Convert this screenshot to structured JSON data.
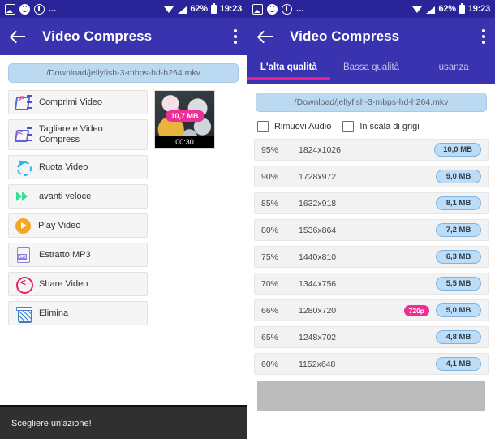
{
  "status_bar": {
    "icons": [
      "photo-icon",
      "smiley-icon",
      "info-icon",
      "more-dots-icon"
    ],
    "dots": "...",
    "battery_percent": "62%",
    "time": "19:23",
    "right_icons": [
      "wifi-icon",
      "signal-icon",
      "battery-icon"
    ]
  },
  "app_bar": {
    "title": "Video Compress",
    "back_icon": "back-arrow-icon",
    "overflow_icon": "overflow-menu-icon"
  },
  "left_screen": {
    "file_path": "/Download/jellyfish-3-mbps-hd-h264.mkv",
    "actions": [
      {
        "label": "Comprimi Video",
        "icon": "compress-video-icon"
      },
      {
        "label": "Tagliare e Video Compress",
        "icon": "cut-video-icon"
      },
      {
        "label": "Ruota Video",
        "icon": "rotate-video-icon"
      },
      {
        "label": "avanti veloce",
        "icon": "fast-forward-icon"
      },
      {
        "label": "Play Video",
        "icon": "play-video-icon"
      },
      {
        "label": "Estratto MP3",
        "icon": "mp3-file-icon"
      },
      {
        "label": "Share Video",
        "icon": "share-icon"
      },
      {
        "label": "Elimina",
        "icon": "trash-icon"
      }
    ],
    "thumbnail": {
      "size_badge": "10,7 MB",
      "duration": "00:30"
    },
    "toast": "Scegliere un'azione!"
  },
  "right_screen": {
    "tabs": [
      {
        "label": "L'alta qualità",
        "active": true
      },
      {
        "label": "Bassa qualità",
        "active": false
      },
      {
        "label": "usanza",
        "active": false
      }
    ],
    "file_path": "/Download/jellyfish-3-mbps-hd-h264.mkv",
    "options": [
      {
        "label": "Rimuovi Audio",
        "checked": false
      },
      {
        "label": "In scala di grigi",
        "checked": false
      }
    ],
    "qualities": [
      {
        "percent": "95%",
        "resolution": "1824x1026",
        "tag": "",
        "size": "10,0 MB"
      },
      {
        "percent": "90%",
        "resolution": "1728x972",
        "tag": "",
        "size": "9,0 MB"
      },
      {
        "percent": "85%",
        "resolution": "1632x918",
        "tag": "",
        "size": "8,1 MB"
      },
      {
        "percent": "80%",
        "resolution": "1536x864",
        "tag": "",
        "size": "7,2 MB"
      },
      {
        "percent": "75%",
        "resolution": "1440x810",
        "tag": "",
        "size": "6,3 MB"
      },
      {
        "percent": "70%",
        "resolution": "1344x756",
        "tag": "",
        "size": "5,5 MB"
      },
      {
        "percent": "66%",
        "resolution": "1280x720",
        "tag": "720p",
        "size": "5,0 MB"
      },
      {
        "percent": "65%",
        "resolution": "1248x702",
        "tag": "",
        "size": "4,8 MB"
      },
      {
        "percent": "60%",
        "resolution": "1152x648",
        "tag": "",
        "size": "4,1 MB"
      }
    ]
  },
  "colors": {
    "status_bar": "#2a249b",
    "app_bar": "#3a33b0",
    "accent_pink": "#ec2e95",
    "pill_blue": "#bcd9f2",
    "size_badge_blue": "#bcdcf7",
    "row_grey": "#f2f2f2",
    "toast_dark": "#303030"
  }
}
